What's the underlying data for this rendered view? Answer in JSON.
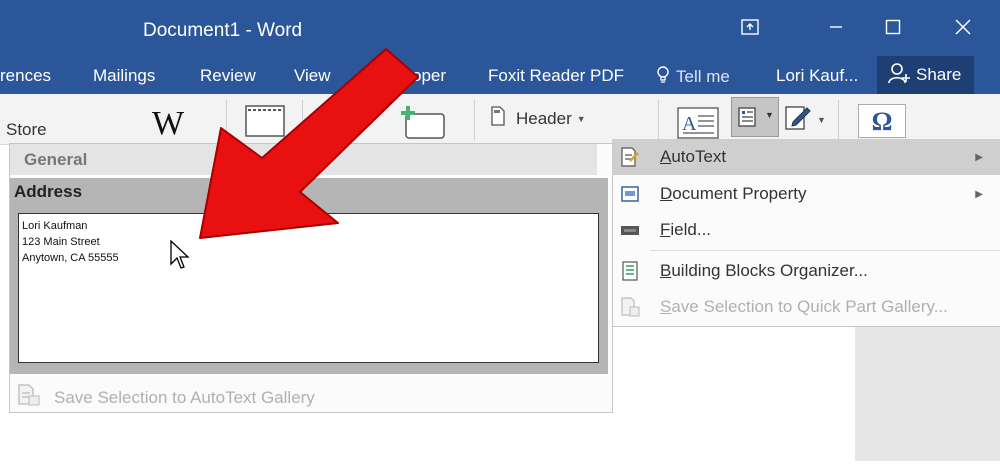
{
  "window": {
    "title": "Document1 - Word",
    "title_bg": "#2b579a"
  },
  "tabs": [
    {
      "label": "rences"
    },
    {
      "label": "Mailings"
    },
    {
      "label": "Review"
    },
    {
      "label": "View"
    },
    {
      "label": "oper"
    },
    {
      "label": "Foxit Reader PDF"
    },
    {
      "label": "Tell me"
    },
    {
      "label": "Lori Kauf..."
    }
  ],
  "share_label": "Share",
  "ribbon": {
    "store_label": "Store",
    "wiki_label": "W",
    "header_label": "Header",
    "omega_label": "Ω"
  },
  "autotext_gallery": {
    "group_header": "General",
    "entry_name": "Address",
    "preview_lines": [
      "Lori Kaufman",
      "123 Main Street",
      "Anytown, CA 55555"
    ],
    "save_label": "Save Selection to AutoText Gallery"
  },
  "quick_parts_menu": {
    "items": [
      {
        "label": "AutoText",
        "underline": "A",
        "rest": "utoText",
        "has_submenu": true,
        "icon": "autotext-icon"
      },
      {
        "label": "Document Property",
        "underline": "D",
        "rest": "ocument Property",
        "has_submenu": true,
        "icon": "document-property-icon"
      },
      {
        "label": "Field...",
        "underline": "F",
        "rest": "ield...",
        "has_submenu": false,
        "icon": "field-icon"
      },
      {
        "label": "Building Blocks Organizer...",
        "underline": "B",
        "rest": "uilding Blocks Organizer...",
        "has_submenu": false,
        "icon": "building-blocks-icon"
      },
      {
        "label": "Save Selection to Quick Part Gallery...",
        "underline": "S",
        "rest": "ave Selection to Quick Part Gallery...",
        "has_submenu": false,
        "icon": "save-quickpart-icon",
        "disabled": true
      }
    ]
  },
  "colors": {
    "accent": "#2b579a",
    "arrow": "#e81010",
    "menu_highlight": "#cfcfcf"
  }
}
